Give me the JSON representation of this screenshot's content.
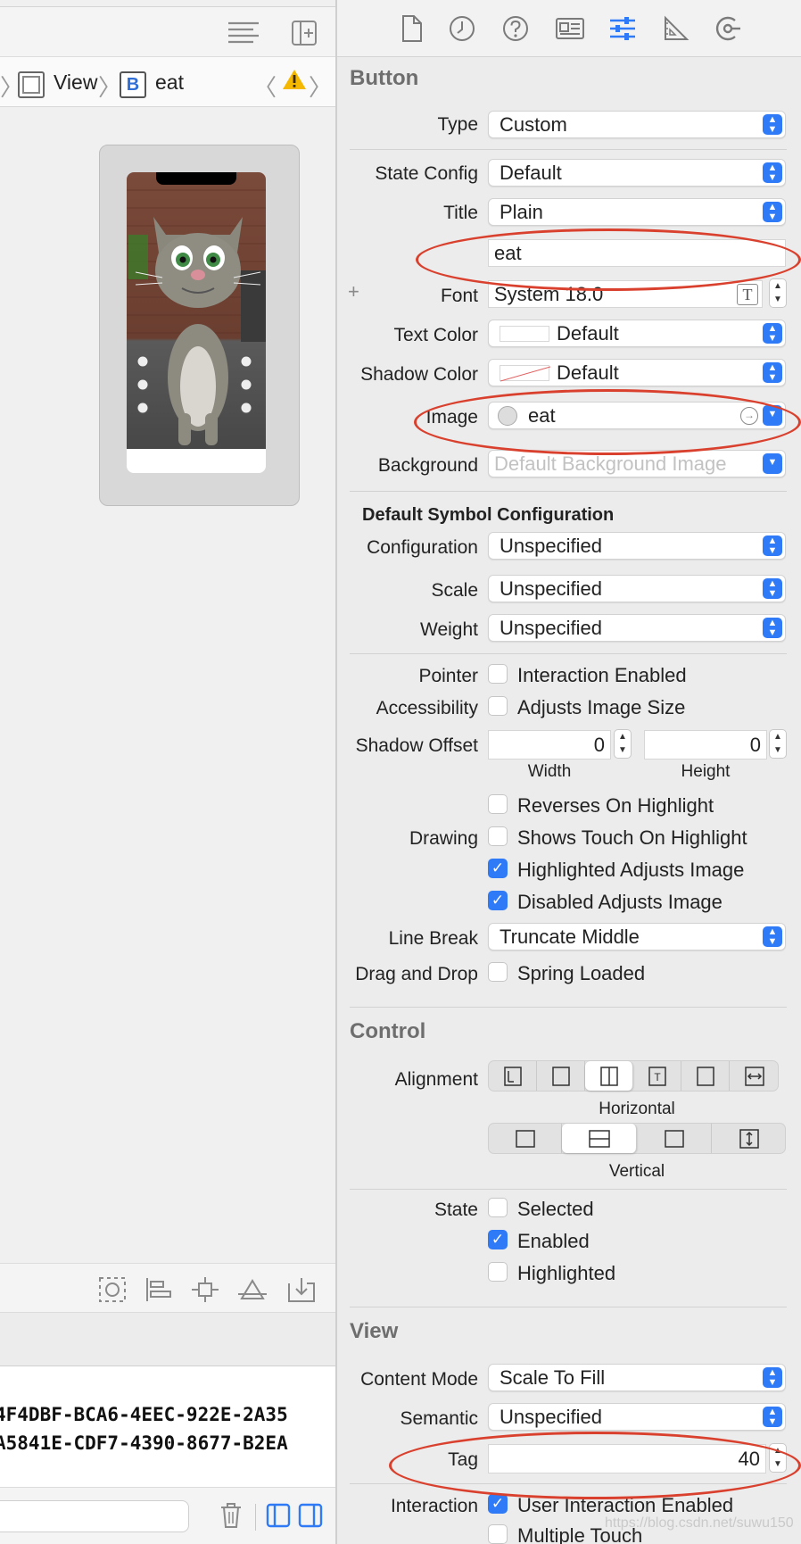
{
  "breadcrumb": {
    "view_label": "View",
    "button_badge": "B",
    "button_label": "eat"
  },
  "console": {
    "line1": "4F4DBF-BCA6-4EEC-922E-2A35",
    "line2": "A5841E-CDF7-4390-8677-B2EA"
  },
  "inspector": {
    "tabs": [
      "file",
      "history",
      "help",
      "identity",
      "attributes",
      "size",
      "connections"
    ],
    "active_tab": "attributes",
    "button": {
      "title": "Button",
      "type_label": "Type",
      "type_value": "Custom",
      "state_config_label": "State Config",
      "state_config_value": "Default",
      "title_label": "Title",
      "title_value": "Plain",
      "title_text": "eat",
      "font_label": "Font",
      "font_value": "System 18.0",
      "text_color_label": "Text Color",
      "text_color_value": "Default",
      "shadow_color_label": "Shadow Color",
      "shadow_color_value": "Default",
      "image_label": "Image",
      "image_value": "eat",
      "background_label": "Background",
      "background_placeholder": "Default Background Image",
      "symbol_config_title": "Default Symbol Configuration",
      "configuration_label": "Configuration",
      "configuration_value": "Unspecified",
      "scale_label": "Scale",
      "scale_value": "Unspecified",
      "weight_label": "Weight",
      "weight_value": "Unspecified",
      "pointer_label": "Pointer",
      "pointer_option": "Interaction Enabled",
      "accessibility_label": "Accessibility",
      "accessibility_option": "Adjusts Image Size",
      "shadow_offset_label": "Shadow Offset",
      "shadow_offset_width": "0",
      "shadow_offset_height": "0",
      "width_caption": "Width",
      "height_caption": "Height",
      "drawing_label": "Drawing",
      "drawing_options": [
        {
          "label": "Reverses On Highlight",
          "checked": false
        },
        {
          "label": "Shows Touch On Highlight",
          "checked": false
        },
        {
          "label": "Highlighted Adjusts Image",
          "checked": true
        },
        {
          "label": "Disabled Adjusts Image",
          "checked": true
        }
      ],
      "line_break_label": "Line Break",
      "line_break_value": "Truncate Middle",
      "drag_drop_label": "Drag and Drop",
      "drag_drop_option": "Spring Loaded"
    },
    "control": {
      "title": "Control",
      "alignment_label": "Alignment",
      "horizontal_caption": "Horizontal",
      "vertical_caption": "Vertical",
      "state_label": "State",
      "states": [
        {
          "label": "Selected",
          "checked": false
        },
        {
          "label": "Enabled",
          "checked": true
        },
        {
          "label": "Highlighted",
          "checked": false
        }
      ]
    },
    "view": {
      "title": "View",
      "content_mode_label": "Content Mode",
      "content_mode_value": "Scale To Fill",
      "semantic_label": "Semantic",
      "semantic_value": "Unspecified",
      "tag_label": "Tag",
      "tag_value": "40",
      "interaction_label": "Interaction",
      "interaction_options": [
        {
          "label": "User Interaction Enabled",
          "checked": true
        },
        {
          "label": "Multiple Touch",
          "checked": false
        }
      ]
    }
  },
  "watermark": "https://blog.csdn.net/suwu150",
  "colors": {
    "accent": "#2f7af6",
    "annotation": "#d9412e",
    "warning": "#f5b800"
  }
}
